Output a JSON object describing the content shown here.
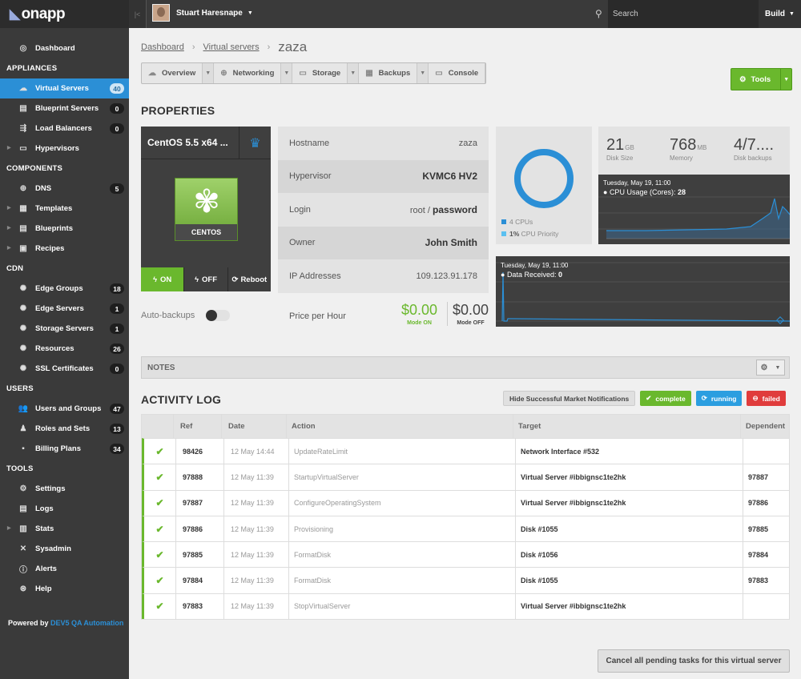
{
  "brand": {
    "logo_text": "onapp"
  },
  "topbar": {
    "user_name": "Stuart Haresnape",
    "search_placeholder": "Search",
    "build_label": "Build"
  },
  "sidebar": {
    "dashboard": "Dashboard",
    "sections": [
      {
        "title": "APPLIANCES",
        "items": [
          {
            "label": "Virtual Servers",
            "badge": "40",
            "icon": "cloud-icon",
            "active": true
          },
          {
            "label": "Blueprint Servers",
            "badge": "0",
            "icon": "blueprint-icon"
          },
          {
            "label": "Load Balancers",
            "badge": "0",
            "icon": "load-balancer-icon"
          },
          {
            "label": "Hypervisors",
            "badge": "",
            "icon": "server-icon",
            "expandable": true
          }
        ]
      },
      {
        "title": "COMPONENTS",
        "items": [
          {
            "label": "DNS",
            "badge": "5",
            "icon": "globe-icon"
          },
          {
            "label": "Templates",
            "badge": "",
            "icon": "templates-icon",
            "expandable": true
          },
          {
            "label": "Blueprints",
            "badge": "",
            "icon": "blueprints-icon",
            "expandable": true
          },
          {
            "label": "Recipes",
            "badge": "",
            "icon": "recipes-icon",
            "expandable": true
          }
        ]
      },
      {
        "title": "CDN",
        "items": [
          {
            "label": "Edge Groups",
            "badge": "18",
            "icon": "edge-groups-icon"
          },
          {
            "label": "Edge Servers",
            "badge": "1",
            "icon": "edge-servers-icon"
          },
          {
            "label": "Storage Servers",
            "badge": "1",
            "icon": "storage-servers-icon"
          },
          {
            "label": "Resources",
            "badge": "26",
            "icon": "resources-icon"
          },
          {
            "label": "SSL Certificates",
            "badge": "0",
            "icon": "ssl-icon"
          }
        ]
      },
      {
        "title": "USERS",
        "items": [
          {
            "label": "Users and Groups",
            "badge": "47",
            "icon": "users-icon"
          },
          {
            "label": "Roles and Sets",
            "badge": "13",
            "icon": "roles-icon"
          },
          {
            "label": "Billing Plans",
            "badge": "34",
            "icon": "billing-icon"
          }
        ]
      },
      {
        "title": "TOOLS",
        "items": [
          {
            "label": "Settings",
            "badge": "",
            "icon": "gear-icon"
          },
          {
            "label": "Logs",
            "badge": "",
            "icon": "logs-icon"
          },
          {
            "label": "Stats",
            "badge": "",
            "icon": "stats-icon",
            "expandable": true
          },
          {
            "label": "Sysadmin",
            "badge": "",
            "icon": "wrench-icon"
          },
          {
            "label": "Alerts",
            "badge": "",
            "icon": "alert-icon"
          },
          {
            "label": "Help",
            "badge": "",
            "icon": "help-icon"
          }
        ]
      }
    ],
    "powered_prefix": "Powered by",
    "powered_link": "DEV5 QA Automation"
  },
  "breadcrumb": {
    "items": [
      "Dashboard",
      "Virtual servers"
    ],
    "current": "zaza"
  },
  "tabs": [
    {
      "label": "Overview",
      "icon": "overview-icon",
      "dropdown": true
    },
    {
      "label": "Networking",
      "icon": "globe-icon",
      "dropdown": true
    },
    {
      "label": "Storage",
      "icon": "storage-icon",
      "dropdown": true
    },
    {
      "label": "Backups",
      "icon": "backups-icon",
      "dropdown": true
    },
    {
      "label": "Console",
      "icon": "console-icon",
      "dropdown": false
    }
  ],
  "tools_label": "Tools",
  "properties_title": "PROPERTIES",
  "vm": {
    "title": "CentOS 5.5 x64 ...",
    "os_label": "CENTOS",
    "power": {
      "on": "ON",
      "off": "OFF",
      "reboot": "Reboot"
    },
    "autobackups_label": "Auto-backups"
  },
  "props": [
    {
      "key": "Hostname",
      "value": "zaza"
    },
    {
      "key": "Hypervisor",
      "value": "KVMC6 HV2"
    },
    {
      "key": "Login",
      "value_user": "root",
      "value_sep": " / ",
      "value_pass": "password"
    },
    {
      "key": "Owner",
      "value": "John Smith"
    },
    {
      "key": "IP Addresses",
      "value": "109.123.91.178"
    }
  ],
  "price": {
    "label": "Price per Hour",
    "on_value": "$0.00",
    "on_label": "Mode ON",
    "off_value": "$0.00",
    "off_label": "Mode OFF"
  },
  "cpu": {
    "cpus_label": "4 CPUs",
    "priority_value": "1%",
    "priority_label": "CPU Priority"
  },
  "stats": {
    "disk": {
      "value": "21",
      "unit": "GB",
      "label": "Disk Size"
    },
    "memory": {
      "value": "768",
      "unit": "MB",
      "label": "Memory"
    },
    "backups": {
      "value": "4/7....",
      "label": "Disk backups"
    }
  },
  "cpu_chart": {
    "date": "Tuesday, May 19, 11:00",
    "label": "CPU Usage (Cores):",
    "value": "28"
  },
  "net_chart": {
    "date": "Tuesday, May 19, 11:00",
    "label": "Data Received:",
    "value": "0"
  },
  "notes_title": "NOTES",
  "activity": {
    "title": "ACTIVITY LOG",
    "hide_btn": "Hide Successful Market Notifications",
    "complete_btn": "complete",
    "running_btn": "running",
    "failed_btn": "failed",
    "columns": [
      "",
      "Ref",
      "Date",
      "Action",
      "Target",
      "Dependent"
    ],
    "rows": [
      {
        "ref": "98426",
        "date": "12 May 14:44",
        "action": "UpdateRateLimit",
        "target": "Network Interface #532",
        "dependent": ""
      },
      {
        "ref": "97888",
        "date": "12 May 11:39",
        "action": "StartupVirtualServer",
        "target": "Virtual Server #ibbignsc1te2hk",
        "dependent": "97887"
      },
      {
        "ref": "97887",
        "date": "12 May 11:39",
        "action": "ConfigureOperatingSystem",
        "target": "Virtual Server #ibbignsc1te2hk",
        "dependent": "97886"
      },
      {
        "ref": "97886",
        "date": "12 May 11:39",
        "action": "Provisioning",
        "target": "Disk #1055",
        "dependent": "97885"
      },
      {
        "ref": "97885",
        "date": "12 May 11:39",
        "action": "FormatDisk",
        "target": "Disk #1056",
        "dependent": "97884"
      },
      {
        "ref": "97884",
        "date": "12 May 11:39",
        "action": "FormatDisk",
        "target": "Disk #1055",
        "dependent": "97883"
      },
      {
        "ref": "97883",
        "date": "12 May 11:39",
        "action": "StopVirtualServer",
        "target": "Virtual Server #ibbignsc1te2hk",
        "dependent": ""
      }
    ]
  },
  "cancel_btn": "Cancel all pending tasks for this virtual server",
  "colors": {
    "accent": "#2b8fd6",
    "success": "#6ab82d",
    "danger": "#e03c3c",
    "running": "#2b9ee0"
  }
}
